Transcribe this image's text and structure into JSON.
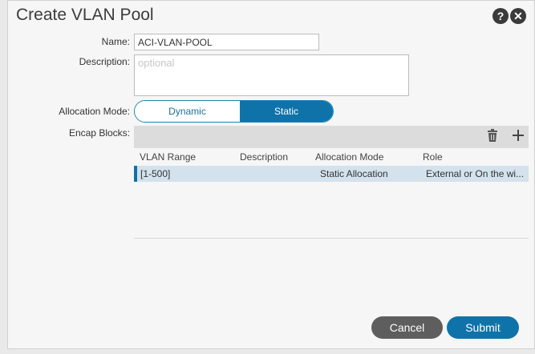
{
  "dialog": {
    "title": "Create VLAN Pool",
    "help_icon": "?",
    "close_icon": "✕"
  },
  "form": {
    "name_label": "Name:",
    "name_value": "ACI-VLAN-POOL",
    "description_label": "Description:",
    "description_placeholder": "optional",
    "allocation_label": "Allocation Mode:",
    "allocation_options": [
      "Dynamic Allocation",
      "Static Allocation"
    ],
    "allocation_selected": "Static Allocation",
    "encap_label": "Encap Blocks:"
  },
  "encap_table": {
    "toolbar": {
      "delete_icon": "trash-icon",
      "add_icon": "plus-icon"
    },
    "columns": [
      "VLAN Range",
      "Description",
      "Allocation Mode",
      "Role"
    ],
    "rows": [
      {
        "vlan_range": "[1-500]",
        "description": "",
        "allocation_mode": "Static Allocation",
        "role": "External or On the wi..."
      }
    ]
  },
  "footer": {
    "cancel_label": "Cancel",
    "submit_label": "Submit"
  },
  "colors": {
    "accent": "#0f73aa",
    "cancel": "#5e5e5e",
    "selected_row": "#d3e2ec"
  }
}
